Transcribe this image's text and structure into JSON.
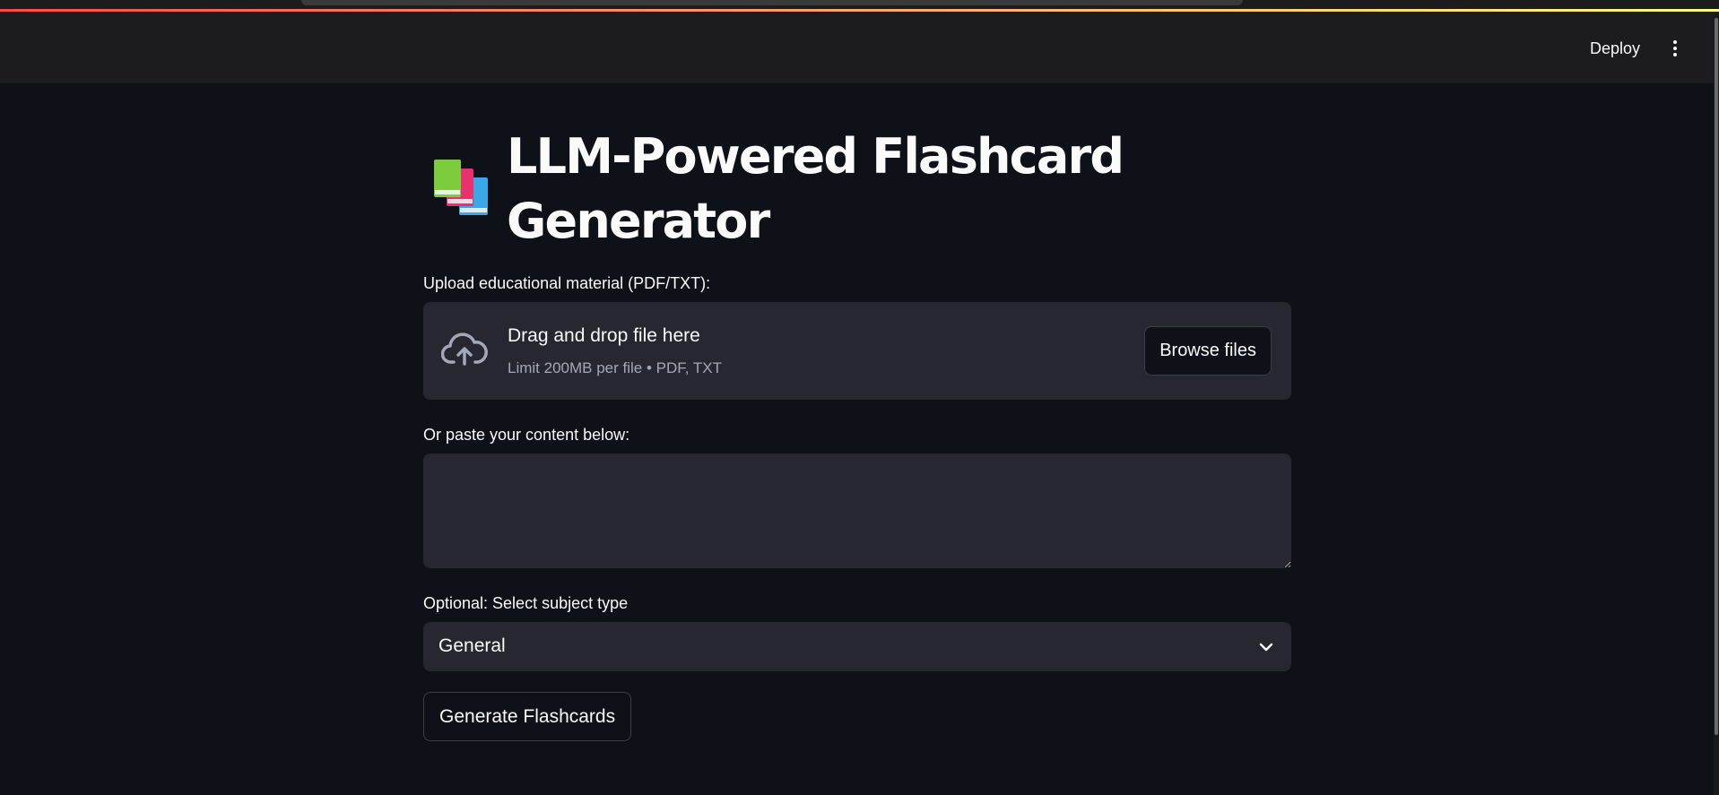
{
  "header": {
    "deploy_label": "Deploy",
    "menu_icon": "kebab-menu-icon"
  },
  "page": {
    "title_icon": "books-emoji-icon",
    "title_line1": "LLM-Powered Flashcard",
    "title_line2": "Generator"
  },
  "upload": {
    "label": "Upload educational material (PDF/TXT):",
    "icon": "cloud-upload-icon",
    "drop_title": "Drag and drop file here",
    "drop_limit": "Limit 200MB per file • PDF, TXT",
    "browse_label": "Browse files"
  },
  "paste": {
    "label": "Or paste your content below:",
    "value": ""
  },
  "subject": {
    "label": "Optional: Select subject type",
    "selected": "General",
    "icon": "chevron-down-icon"
  },
  "actions": {
    "generate_label": "Generate Flashcards"
  },
  "colors": {
    "background": "#0e1117",
    "header": "#1c1c1e",
    "widget": "#262730",
    "text": "#fafafa",
    "muted_text": "#a3a8b8",
    "border": "#3b3d48",
    "accent_gradient_start": "#ff4b4b",
    "accent_gradient_end": "#fffd80"
  }
}
